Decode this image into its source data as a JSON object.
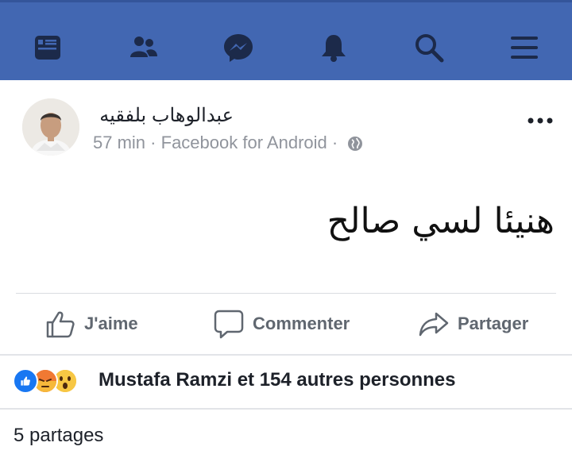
{
  "nav": {
    "icons": [
      "news-feed-icon",
      "friends-icon",
      "messenger-icon",
      "notifications-icon",
      "search-icon",
      "menu-icon"
    ],
    "color": "#4267b2"
  },
  "post": {
    "author": "عبدالوهاب بلفقيه",
    "time": "57 min",
    "separator": "·",
    "source": "Facebook for Android",
    "separator2": "·",
    "privacy_icon": "globe-icon",
    "text": "هنيئا لسي صالح"
  },
  "actions": {
    "like": "J'aime",
    "comment": "Commenter",
    "share": "Partager"
  },
  "reactions": {
    "icons": [
      "like-reaction-icon",
      "angry-reaction-icon",
      "wow-reaction-icon"
    ],
    "summary": "Mustafa Ramzi et 154 autres personnes"
  },
  "shares": "5 partages"
}
